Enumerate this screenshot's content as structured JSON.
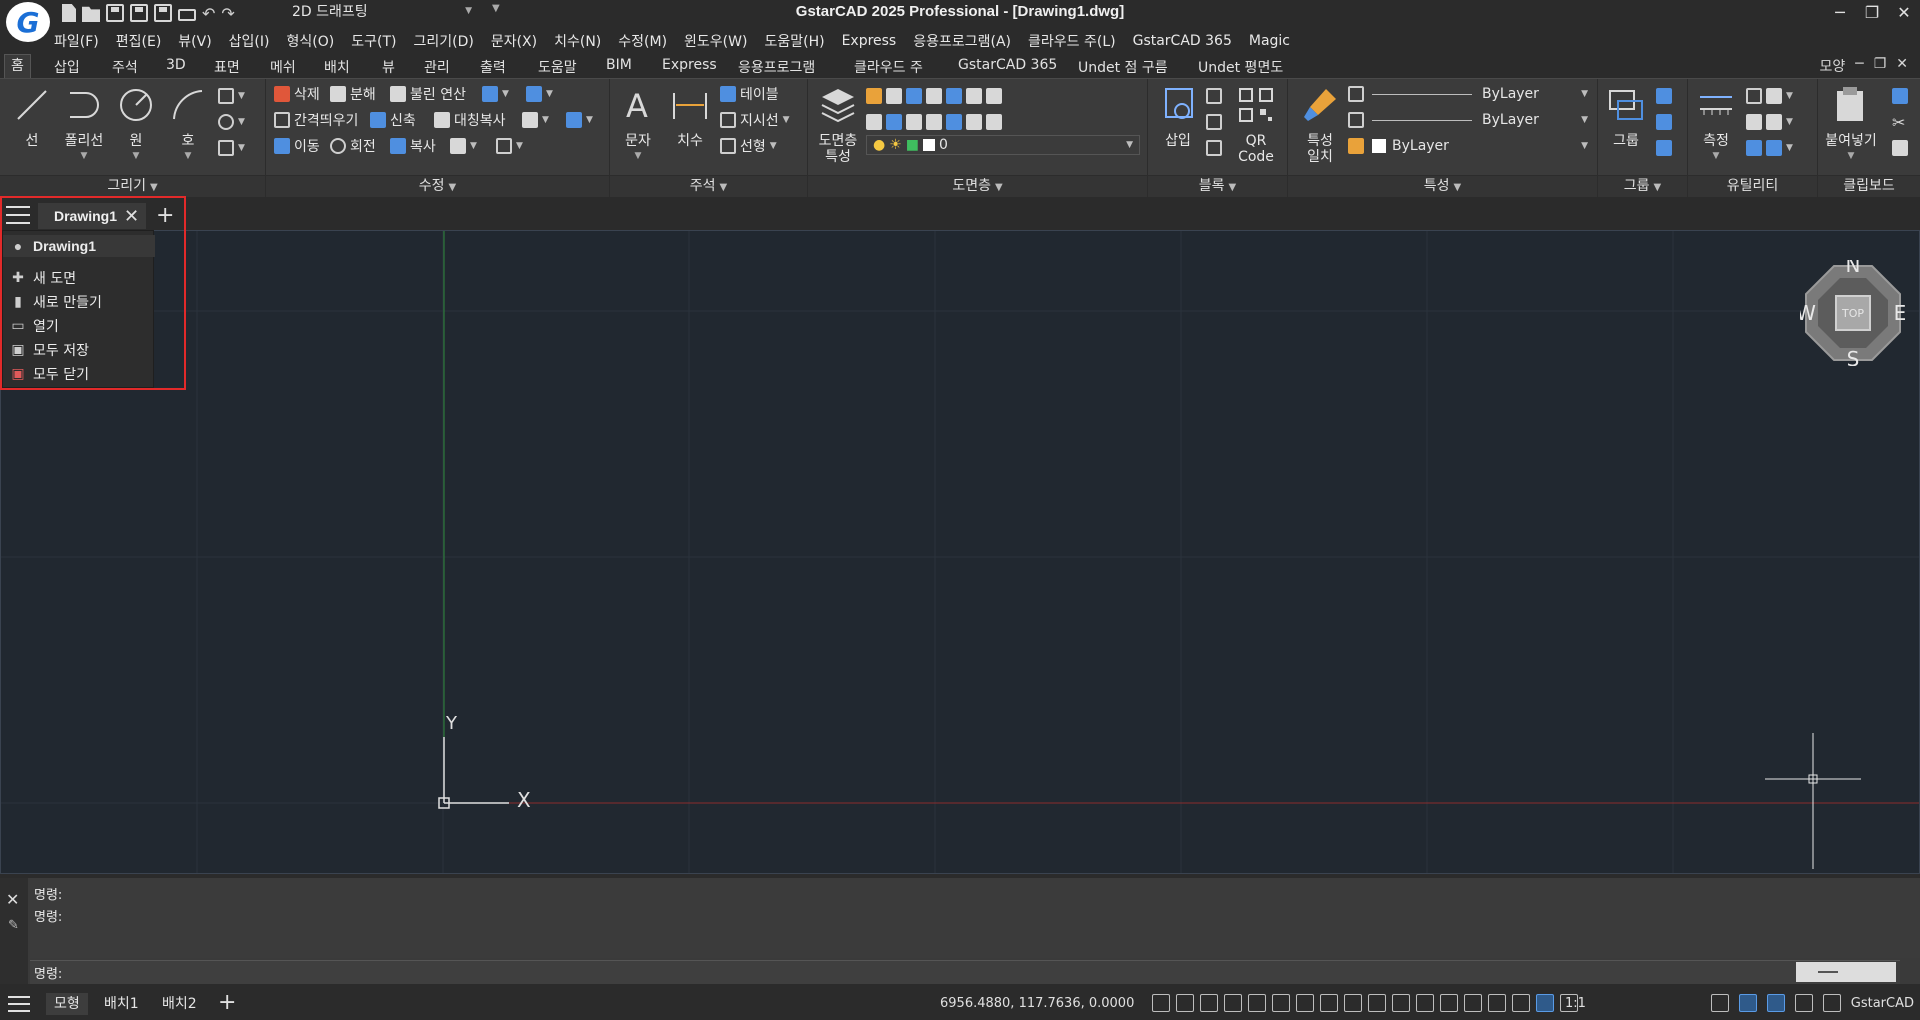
{
  "window": {
    "title": "GstarCAD 2025 Professional - [Drawing1.dwg]",
    "workspace": "2D 드래프팅",
    "controls": [
      "─",
      "❐",
      "✕"
    ]
  },
  "menubar": [
    "파일(F)",
    "편집(E)",
    "뷰(V)",
    "삽입(I)",
    "형식(O)",
    "도구(T)",
    "그리기(D)",
    "문자(X)",
    "치수(N)",
    "수정(M)",
    "윈도우(W)",
    "도움말(H)",
    "Express",
    "응용프로그램(A)",
    "클라우드 주(L)",
    "GstarCAD 365",
    "Magic"
  ],
  "ribbon_tabs": [
    "홈",
    "삽입",
    "주석",
    "3D",
    "표면",
    "메쉬",
    "배치",
    "뷰",
    "관리",
    "출력",
    "도움말",
    "BIM",
    "Express",
    "응용프로그램",
    "클라우드 주",
    "GstarCAD 365",
    "Undet 점 구름",
    "Undet 평면도"
  ],
  "ribbon_right": "모양",
  "panels": {
    "draw": {
      "title": "그리기",
      "line": "선",
      "polyline": "폴리선",
      "circle": "원",
      "arc": "호"
    },
    "modify": {
      "title": "수정",
      "erase": "삭제",
      "explode": "분해",
      "boolean": "불린 연산",
      "offset": "간격띄우기",
      "stretch": "신축",
      "mirror": "대칭복사",
      "move": "이동",
      "rotate": "회전",
      "copy": "복사"
    },
    "annotation": {
      "title": "주석",
      "text": "문자",
      "dimension": "치수",
      "table": "테이블",
      "leader": "지시선",
      "linear": "선형"
    },
    "layer": {
      "title": "도면층",
      "properties_1": "도면층",
      "properties_2": "특성",
      "current_layer": "0"
    },
    "block": {
      "title": "블록",
      "insert": "삽입",
      "qr_1": "QR",
      "qr_2": "Code"
    },
    "properties": {
      "title": "특성",
      "match_1": "특성",
      "match_2": "일치",
      "color": "ByLayer",
      "linetype": "ByLayer",
      "lineweight": "ByLayer"
    },
    "group": {
      "title": "그룹",
      "group": "그룹"
    },
    "utilities": {
      "title": "유틸리티",
      "measure": "측정"
    },
    "clipboard": {
      "title": "클립보드",
      "paste": "붙여넣기"
    }
  },
  "doc_tabs": {
    "active": "Drawing1"
  },
  "doc_menu": {
    "current": "Drawing1",
    "items": [
      {
        "label": "새 도면",
        "icon": "plus-icon"
      },
      {
        "label": "새로 만들기",
        "icon": "document-icon"
      },
      {
        "label": "열기",
        "icon": "folder-icon"
      },
      {
        "label": "모두 저장",
        "icon": "save-all-icon"
      },
      {
        "label": "모두 닫기",
        "icon": "close-all-icon"
      }
    ]
  },
  "viewcube": {
    "n": "N",
    "s": "S",
    "e": "E",
    "w": "W",
    "face": "TOP"
  },
  "ucs": {
    "x": "X",
    "y": "Y"
  },
  "command": {
    "history": [
      "명령:",
      "명령:"
    ],
    "prompt": "명령:"
  },
  "status": {
    "layouts": [
      "모형",
      "배치1",
      "배치2"
    ],
    "coords": "6956.4880, 117.7636, 0.0000",
    "scale": "1:1",
    "app": "GstarCAD"
  },
  "colors": {
    "canvas": "#212830",
    "highlight": "#e22a2a",
    "y_axis": "#2d8a3a",
    "x_axis": "#8a2d2d"
  }
}
